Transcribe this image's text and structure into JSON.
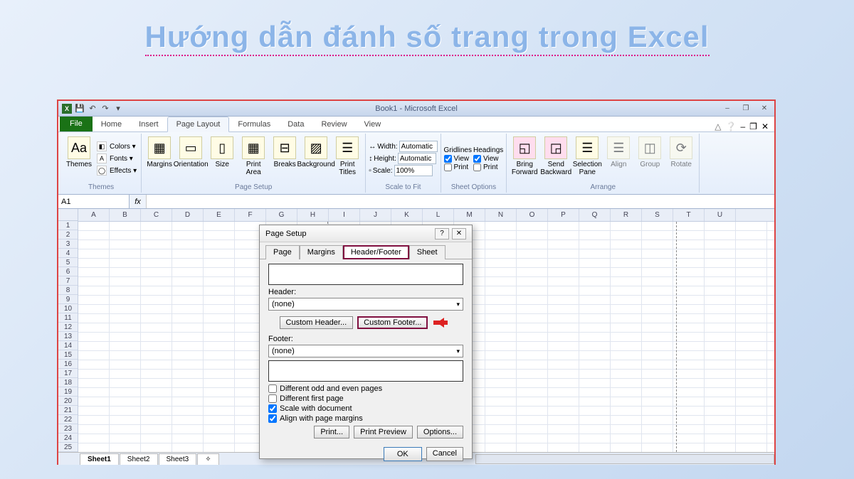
{
  "banner": "Hướng dẫn đánh số trang trong Excel",
  "window": {
    "title": "Book1 - Microsoft Excel"
  },
  "tabs": {
    "file": "File",
    "home": "Home",
    "insert": "Insert",
    "page_layout": "Page Layout",
    "formulas": "Formulas",
    "data": "Data",
    "review": "Review",
    "view": "View"
  },
  "ribbon": {
    "themes": {
      "label": "Themes",
      "btn": "Themes",
      "colors": "Colors ▾",
      "fonts": "Fonts ▾",
      "effects": "Effects ▾"
    },
    "page_setup": {
      "label": "Page Setup",
      "margins": "Margins",
      "orientation": "Orientation",
      "size": "Size",
      "print_area": "Print Area",
      "breaks": "Breaks",
      "background": "Background",
      "print_titles": "Print Titles"
    },
    "scale": {
      "label": "Scale to Fit",
      "width": "Width:",
      "height": "Height:",
      "scale": "Scale:",
      "width_val": "Automatic",
      "height_val": "Automatic",
      "scale_val": "100%"
    },
    "sheet_options": {
      "label": "Sheet Options",
      "gridlines": "Gridlines",
      "headings": "Headings",
      "view": "View",
      "print": "Print"
    },
    "arrange": {
      "label": "Arrange",
      "bring": "Bring Forward",
      "send": "Send Backward",
      "selection": "Selection Pane",
      "align": "Align",
      "group": "Group",
      "rotate": "Rotate"
    }
  },
  "name_box": "A1",
  "columns": [
    "A",
    "B",
    "C",
    "D",
    "E",
    "F",
    "G",
    "H",
    "I",
    "J",
    "K",
    "L",
    "M",
    "N",
    "O",
    "P",
    "Q",
    "R",
    "S",
    "T",
    "U"
  ],
  "rows": [
    1,
    2,
    3,
    4,
    5,
    6,
    7,
    8,
    9,
    10,
    11,
    12,
    13,
    14,
    15,
    16,
    17,
    18,
    19,
    20,
    21,
    22,
    23,
    24,
    25
  ],
  "sheets": [
    "Sheet1",
    "Sheet2",
    "Sheet3"
  ],
  "dialog": {
    "title": "Page Setup",
    "tabs": {
      "page": "Page",
      "margins": "Margins",
      "hf": "Header/Footer",
      "sheet": "Sheet"
    },
    "header_label": "Header:",
    "header_value": "(none)",
    "custom_header": "Custom Header...",
    "custom_footer": "Custom Footer...",
    "footer_label": "Footer:",
    "footer_value": "(none)",
    "chk_odd": "Different odd and even pages",
    "chk_first": "Different first page",
    "chk_scale": "Scale with document",
    "chk_align": "Align with page margins",
    "print": "Print...",
    "preview": "Print Preview",
    "options": "Options...",
    "ok": "OK",
    "cancel": "Cancel"
  }
}
